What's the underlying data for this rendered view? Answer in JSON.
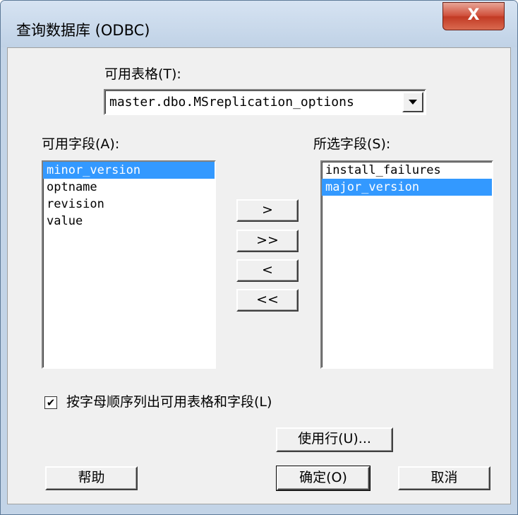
{
  "window": {
    "title": "查询数据库 (ODBC)",
    "close_label": "X"
  },
  "tables": {
    "label": "可用表格(T):",
    "selected": "master.dbo.MSreplication_options"
  },
  "available_fields": {
    "label": "可用字段(A):",
    "items": [
      "minor_version",
      "optname",
      "revision",
      "value"
    ],
    "selected_index": 0
  },
  "selected_fields": {
    "label": "所选字段(S):",
    "items": [
      "install_failures",
      "major_version"
    ],
    "selected_index": 1
  },
  "move_buttons": {
    "add": ">",
    "add_all": ">>",
    "remove": "<",
    "remove_all": "<<"
  },
  "sort_checkbox": {
    "label": "按字母顺序列出可用表格和字段(L)",
    "checked": true,
    "mark": "✔"
  },
  "buttons": {
    "use_rows": "使用行(U)...",
    "help": "帮助",
    "ok": "确定(O)",
    "cancel": "取消"
  },
  "colors": {
    "selection": "#3399ff",
    "dialog_bg": "#f0f0f0",
    "close_button": "#c9452e"
  }
}
